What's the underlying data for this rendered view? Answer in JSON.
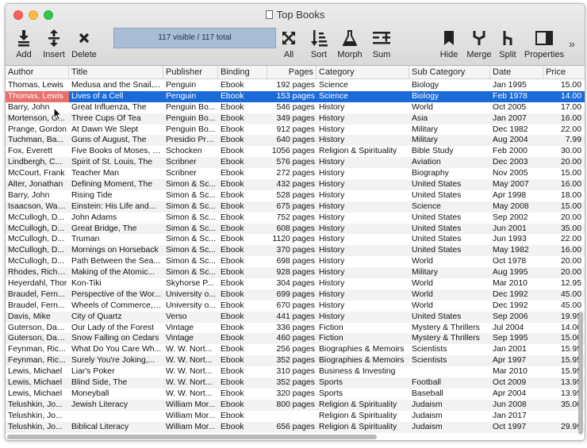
{
  "window": {
    "title": "Top Books"
  },
  "toolbar": {
    "add": "Add",
    "insert": "Insert",
    "delete": "Delete",
    "status": "117 visible / 117 total",
    "all": "All",
    "sort": "Sort",
    "morph": "Morph",
    "sum": "Sum",
    "hide": "Hide",
    "merge": "Merge",
    "split": "Split",
    "properties": "Properties",
    "overflow": "»"
  },
  "columns": [
    "Author",
    "Title",
    "Publisher",
    "Binding",
    "Pages",
    "Category",
    "Sub Category",
    "Date",
    "Price"
  ],
  "rows": [
    {
      "author": "Thomas, Lewis",
      "title": "Medusa and the Snail,...",
      "publisher": "Penguin",
      "binding": "Ebook",
      "pages": "192 pages",
      "category": "Science",
      "sub": "Biology",
      "date": "Jan 1995",
      "price": "15.00"
    },
    {
      "author": "Thomas, Lewis",
      "title": "Lives of a Cell",
      "publisher": "Penguin",
      "binding": "Ebook",
      "pages": "153 pages",
      "category": "Science",
      "sub": "Biology",
      "date": "Feb 1978",
      "price": "14.00"
    },
    {
      "author": "Barry, John",
      "title": "Great Influenza, The",
      "publisher": "Penguin Bo...",
      "binding": "Ebook",
      "pages": "546 pages",
      "category": "History",
      "sub": "World",
      "date": "Oct 2005",
      "price": "17.00"
    },
    {
      "author": "Mortenson, G...",
      "title": "Three Cups Of Tea",
      "publisher": "Penguin Bo...",
      "binding": "Ebook",
      "pages": "349 pages",
      "category": "History",
      "sub": "Asia",
      "date": "Jan 2007",
      "price": "16.00"
    },
    {
      "author": "Prange, Gordon",
      "title": "At Dawn We Slept",
      "publisher": "Penguin Bo...",
      "binding": "Ebook",
      "pages": "912 pages",
      "category": "History",
      "sub": "Military",
      "date": "Dec 1982",
      "price": "22.00"
    },
    {
      "author": "Tuchman, Ba...",
      "title": "Guns of August, The",
      "publisher": "Presidio Press",
      "binding": "Ebook",
      "pages": "640 pages",
      "category": "History",
      "sub": "Military",
      "date": "Aug 2004",
      "price": "7.99"
    },
    {
      "author": "Fox, Everett",
      "title": "Five Books of Moses, The",
      "publisher": "Schocken",
      "binding": "Ebook",
      "pages": "1056 pages",
      "category": "Religion & Spirituality",
      "sub": "Bible Study",
      "date": "Feb 2000",
      "price": "30.00"
    },
    {
      "author": "Lindbergh, C...",
      "title": "Spirit of St. Louis, The",
      "publisher": "Scribner",
      "binding": "Ebook",
      "pages": "576 pages",
      "category": "History",
      "sub": "Aviation",
      "date": "Dec 2003",
      "price": "20.00"
    },
    {
      "author": "McCourt, Frank",
      "title": "Teacher Man",
      "publisher": "Scribner",
      "binding": "Ebook",
      "pages": "272 pages",
      "category": "History",
      "sub": "Biography",
      "date": "Nov 2005",
      "price": "15.00"
    },
    {
      "author": "Alter, Jonathan",
      "title": "Defining Moment, The",
      "publisher": "Simon & Sc...",
      "binding": "Ebook",
      "pages": "432 pages",
      "category": "History",
      "sub": "United States",
      "date": "May 2007",
      "price": "16.00"
    },
    {
      "author": "Barry, John",
      "title": "Rising Tide",
      "publisher": "Simon & Sc...",
      "binding": "Ebook",
      "pages": "528 pages",
      "category": "History",
      "sub": "United States",
      "date": "Apr 1998",
      "price": "18.00"
    },
    {
      "author": "Isaacson, Walter",
      "title": "Einstein: His Life and...",
      "publisher": "Simon & Sc...",
      "binding": "Ebook",
      "pages": "675 pages",
      "category": "History",
      "sub": "Science",
      "date": "May 2008",
      "price": "15.00"
    },
    {
      "author": "McCullogh, D...",
      "title": "John Adams",
      "publisher": "Simon & Sc...",
      "binding": "Ebook",
      "pages": "752 pages",
      "category": "History",
      "sub": "United States",
      "date": "Sep 2002",
      "price": "20.00"
    },
    {
      "author": "McCullogh, D...",
      "title": "Great Bridge, The",
      "publisher": "Simon & Sc...",
      "binding": "Ebook",
      "pages": "608 pages",
      "category": "History",
      "sub": "United States",
      "date": "Jun 2001",
      "price": "35.00"
    },
    {
      "author": "McCullogh, D...",
      "title": "Truman",
      "publisher": "Simon & Sc...",
      "binding": "Ebook",
      "pages": "1120 pages",
      "category": "History",
      "sub": "United States",
      "date": "Jun 1993",
      "price": "22.00"
    },
    {
      "author": "McCullogh, D...",
      "title": "Mornings on Horseback",
      "publisher": "Simon & Sc...",
      "binding": "Ebook",
      "pages": "370 pages",
      "category": "History",
      "sub": "United States",
      "date": "May 1982",
      "price": "16.00"
    },
    {
      "author": "McCullogh, D...",
      "title": "Path Between the Sea...",
      "publisher": "Simon & Sc...",
      "binding": "Ebook",
      "pages": "698 pages",
      "category": "History",
      "sub": "World",
      "date": "Oct 1978",
      "price": "20.00"
    },
    {
      "author": "Rhodes, Richard",
      "title": "Making of the Atomic...",
      "publisher": "Simon & Sc...",
      "binding": "Ebook",
      "pages": "928 pages",
      "category": "History",
      "sub": "Military",
      "date": "Aug 1995",
      "price": "20.00"
    },
    {
      "author": "Heyerdahl, Thor",
      "title": "Kon-Tiki",
      "publisher": "Skyhorse P...",
      "binding": "Ebook",
      "pages": "304 pages",
      "category": "History",
      "sub": "World",
      "date": "Mar 2010",
      "price": "12.95"
    },
    {
      "author": "Braudel, Fern...",
      "title": "Perspective of the Wor...",
      "publisher": "University o...",
      "binding": "Ebook",
      "pages": "699 pages",
      "category": "History",
      "sub": "World",
      "date": "Dec 1992",
      "price": "45.00"
    },
    {
      "author": "Braudel, Fern...",
      "title": "Wheels of Commerce, The",
      "publisher": "University o...",
      "binding": "Ebook",
      "pages": "670 pages",
      "category": "History",
      "sub": "World",
      "date": "Dec 1992",
      "price": "45.00"
    },
    {
      "author": "Davis, Mike",
      "title": "City of Quartz",
      "publisher": "Verso",
      "binding": "Ebook",
      "pages": "441 pages",
      "category": "History",
      "sub": "United States",
      "date": "Sep 2006",
      "price": "19.95"
    },
    {
      "author": "Guterson, David",
      "title": "Our Lady of the Forest",
      "publisher": "Vintage",
      "binding": "Ebook",
      "pages": "336 pages",
      "category": "Fiction",
      "sub": "Mystery & Thrillers",
      "date": "Jul 2004",
      "price": "14.00"
    },
    {
      "author": "Guterson, David",
      "title": "Snow Falling on Cedars",
      "publisher": "Vintage",
      "binding": "Ebook",
      "pages": "460 pages",
      "category": "Fiction",
      "sub": "Mystery & Thrillers",
      "date": "Sep 1995",
      "price": "15.00"
    },
    {
      "author": "Feynman, Ric...",
      "title": "What Do You Care Wh...",
      "publisher": "W. W. Nort...",
      "binding": "Ebook",
      "pages": "256 pages",
      "category": "Biographies & Memoirs",
      "sub": "Scientists",
      "date": "Jan 2001",
      "price": "15.95"
    },
    {
      "author": "Feynman, Ric...",
      "title": "Surely You're Joking,...",
      "publisher": "W. W. Nort...",
      "binding": "Ebook",
      "pages": "352 pages",
      "category": "Biographies & Memoirs",
      "sub": "Scientists",
      "date": "Apr 1997",
      "price": "15.95"
    },
    {
      "author": "Lewis, Michael",
      "title": "Liar's Poker",
      "publisher": "W. W. Nort...",
      "binding": "Ebook",
      "pages": "310 pages",
      "category": "Business & Investing",
      "sub": "",
      "date": "Mar 2010",
      "price": "15.95"
    },
    {
      "author": "Lewis, Michael",
      "title": "Blind Side, The",
      "publisher": "W. W. Nort...",
      "binding": "Ebook",
      "pages": "352 pages",
      "category": "Sports",
      "sub": "Football",
      "date": "Oct 2009",
      "price": "13.95"
    },
    {
      "author": "Lewis, Michael",
      "title": "Moneyball",
      "publisher": "W. W. Nort...",
      "binding": "Ebook",
      "pages": "320 pages",
      "category": "Sports",
      "sub": "Baseball",
      "date": "Apr 2004",
      "price": "13.95"
    },
    {
      "author": "Telushkin, Jo...",
      "title": "Jewish Literacy",
      "publisher": "William Mor...",
      "binding": "Ebook",
      "pages": "800 pages",
      "category": "Religion & Spirituality",
      "sub": "Judaism",
      "date": "Jun 2008",
      "price": "35.00"
    },
    {
      "author": "Telushkin, Jo...",
      "title": "",
      "publisher": "William Mor...",
      "binding": "Ebook",
      "pages": "",
      "category": "Religion & Spirituality",
      "sub": "Judaism",
      "date": "Jan 2017",
      "price": ""
    },
    {
      "author": "Telushkin, Jo...",
      "title": "Biblical Literacy",
      "publisher": "William Mor...",
      "binding": "Ebook",
      "pages": "656 pages",
      "category": "Religion & Spirituality",
      "sub": "Judaism",
      "date": "Oct 1997",
      "price": "29.99"
    }
  ],
  "selection": {
    "row_index": 1,
    "highlight_color": "#1a6bd8",
    "author_cell_color": "#e8706a"
  }
}
